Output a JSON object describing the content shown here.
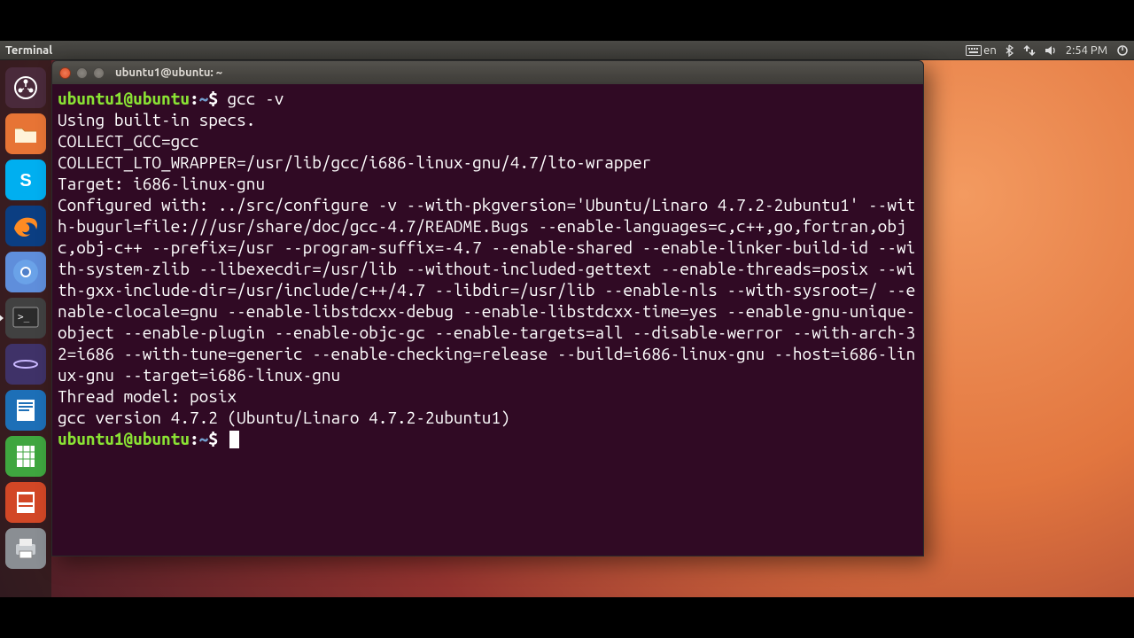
{
  "menubar": {
    "app": "Terminal",
    "lang": "en",
    "clock": "2:54 PM"
  },
  "launcher": {
    "items": [
      {
        "name": "dash-icon",
        "bg": "#4a2a3b",
        "active": false
      },
      {
        "name": "files-icon",
        "bg": "#e77435",
        "active": false
      },
      {
        "name": "skype-icon",
        "bg": "#00aff0",
        "active": false
      },
      {
        "name": "firefox-icon",
        "bg": "#0b3e82",
        "active": false
      },
      {
        "name": "chromium-icon",
        "bg": "#5f8edb",
        "active": false
      },
      {
        "name": "terminal-icon",
        "bg": "#414141",
        "active": true
      },
      {
        "name": "eclipse-icon",
        "bg": "#3f3268",
        "active": false
      },
      {
        "name": "writer-icon",
        "bg": "#1d6fb7",
        "active": false
      },
      {
        "name": "calc-icon",
        "bg": "#3fa63f",
        "active": false
      },
      {
        "name": "impress-icon",
        "bg": "#d24726",
        "active": false
      },
      {
        "name": "printer-icon",
        "bg": "#8a8e93",
        "active": false
      }
    ]
  },
  "terminal": {
    "title": "ubuntu1@ubuntu: ~",
    "prompt": {
      "user": "ubuntu1@ubuntu",
      "path": "~",
      "symbol": "$"
    },
    "command": "gcc -v",
    "output": "Using built-in specs.\nCOLLECT_GCC=gcc\nCOLLECT_LTO_WRAPPER=/usr/lib/gcc/i686-linux-gnu/4.7/lto-wrapper\nTarget: i686-linux-gnu\nConfigured with: ../src/configure -v --with-pkgversion='Ubuntu/Linaro 4.7.2-2ubuntu1' --with-bugurl=file:///usr/share/doc/gcc-4.7/README.Bugs --enable-languages=c,c++,go,fortran,objc,obj-c++ --prefix=/usr --program-suffix=-4.7 --enable-shared --enable-linker-build-id --with-system-zlib --libexecdir=/usr/lib --without-included-gettext --enable-threads=posix --with-gxx-include-dir=/usr/include/c++/4.7 --libdir=/usr/lib --enable-nls --with-sysroot=/ --enable-clocale=gnu --enable-libstdcxx-debug --enable-libstdcxx-time=yes --enable-gnu-unique-object --enable-plugin --enable-objc-gc --enable-targets=all --disable-werror --with-arch-32=i686 --with-tune=generic --enable-checking=release --build=i686-linux-gnu --host=i686-linux-gnu --target=i686-linux-gnu\nThread model: posix\ngcc version 4.7.2 (Ubuntu/Linaro 4.7.2-2ubuntu1)"
  }
}
